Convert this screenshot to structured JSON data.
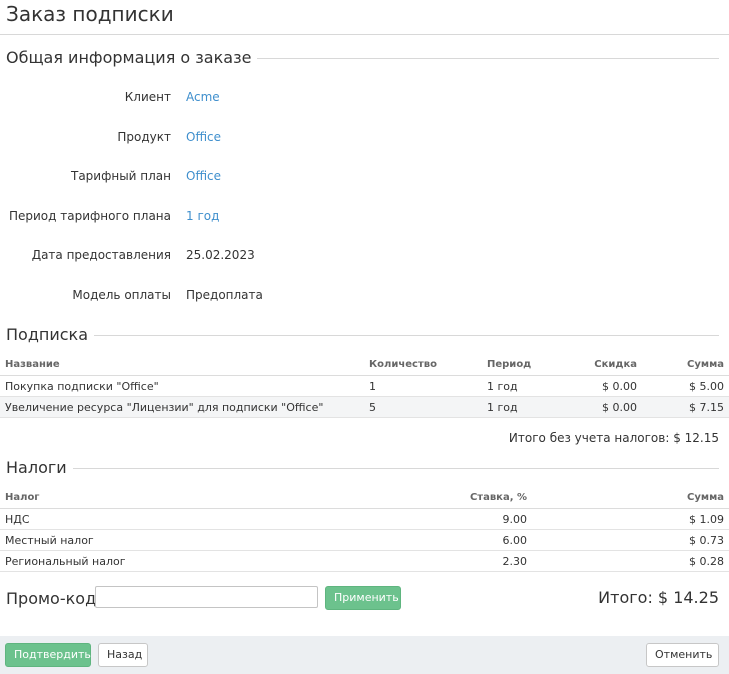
{
  "page": {
    "title": "Заказ подписки"
  },
  "general": {
    "heading": "Общая информация о заказе",
    "rows": [
      {
        "label": "Клиент",
        "value": "Acme",
        "link": true
      },
      {
        "label": "Продукт",
        "value": "Office",
        "link": true
      },
      {
        "label": "Тарифный план",
        "value": "Office",
        "link": true
      },
      {
        "label": "Период тарифного плана",
        "value": "1 год",
        "link": true
      },
      {
        "label": "Дата предоставления",
        "value": "25.02.2023",
        "link": false
      },
      {
        "label": "Модель оплаты",
        "value": "Предоплата",
        "link": false
      }
    ]
  },
  "subscription": {
    "heading": "Подписка",
    "columns": [
      "Название",
      "Количество",
      "Период",
      "Скидка",
      "Сумма"
    ],
    "rows": [
      [
        "Покупка подписки \"Office\"",
        "1",
        "1 год",
        "$ 0.00",
        "$ 5.00"
      ],
      [
        "Увеличение ресурса \"Лицензии\" для подписки \"Office\"",
        "5",
        "1 год",
        "$ 0.00",
        "$ 7.15"
      ]
    ],
    "subtotal": "Итого без учета налогов: $ 12.15"
  },
  "taxes": {
    "heading": "Налоги",
    "columns": [
      "Налог",
      "Ставка, %",
      "Сумма"
    ],
    "rows": [
      [
        "НДС",
        "9.00",
        "$ 1.09"
      ],
      [
        "Местный налог",
        "6.00",
        "$ 0.73"
      ],
      [
        "Региональный налог",
        "2.30",
        "$ 0.28"
      ]
    ]
  },
  "promo": {
    "label": "Промо-код",
    "value": "",
    "placeholder": "",
    "apply_label": "Применить"
  },
  "total": "Итого: $ 14.25",
  "footer": {
    "confirm_label": "Подтвердить",
    "back_label": "Назад",
    "cancel_label": "Отменить"
  },
  "colors": {
    "link": "#3f8fcd",
    "accent_green": "#6cc28d",
    "footer_bg": "#eceff2"
  }
}
